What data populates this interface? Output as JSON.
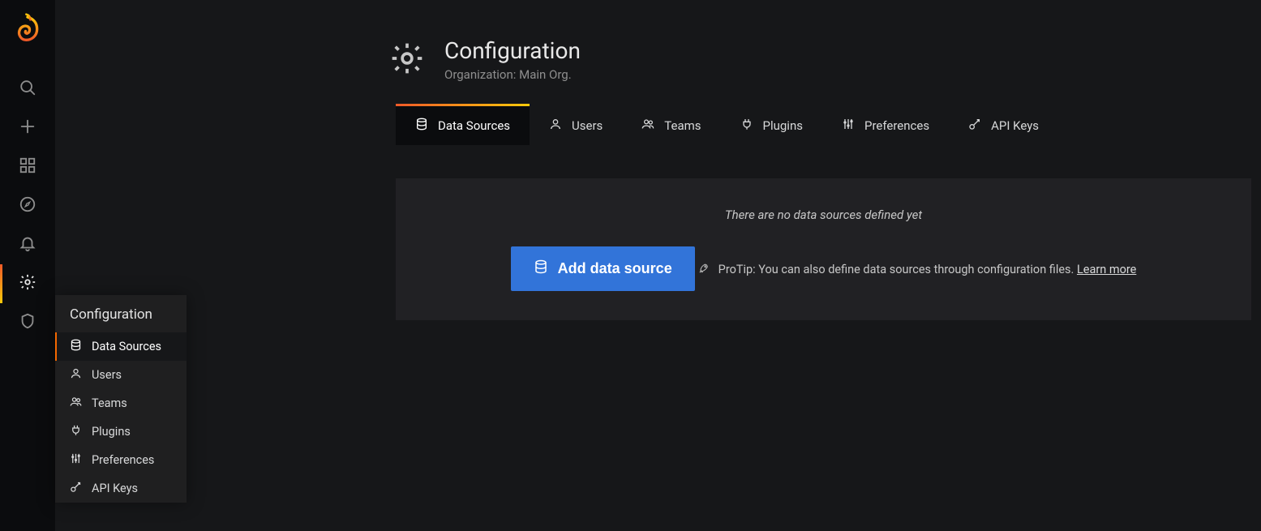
{
  "page": {
    "title": "Configuration",
    "subtitle": "Organization: Main Org."
  },
  "tabs": [
    {
      "label": "Data Sources"
    },
    {
      "label": "Users"
    },
    {
      "label": "Teams"
    },
    {
      "label": "Plugins"
    },
    {
      "label": "Preferences"
    },
    {
      "label": "API Keys"
    }
  ],
  "flyout": {
    "header": "Configuration",
    "items": [
      {
        "label": "Data Sources"
      },
      {
        "label": "Users"
      },
      {
        "label": "Teams"
      },
      {
        "label": "Plugins"
      },
      {
        "label": "Preferences"
      },
      {
        "label": "API Keys"
      }
    ]
  },
  "empty_state": {
    "message": "There are no data sources defined yet",
    "button_label": "Add data source",
    "protip_prefix": "ProTip: You can also define data sources through configuration files. ",
    "protip_link": "Learn more"
  }
}
